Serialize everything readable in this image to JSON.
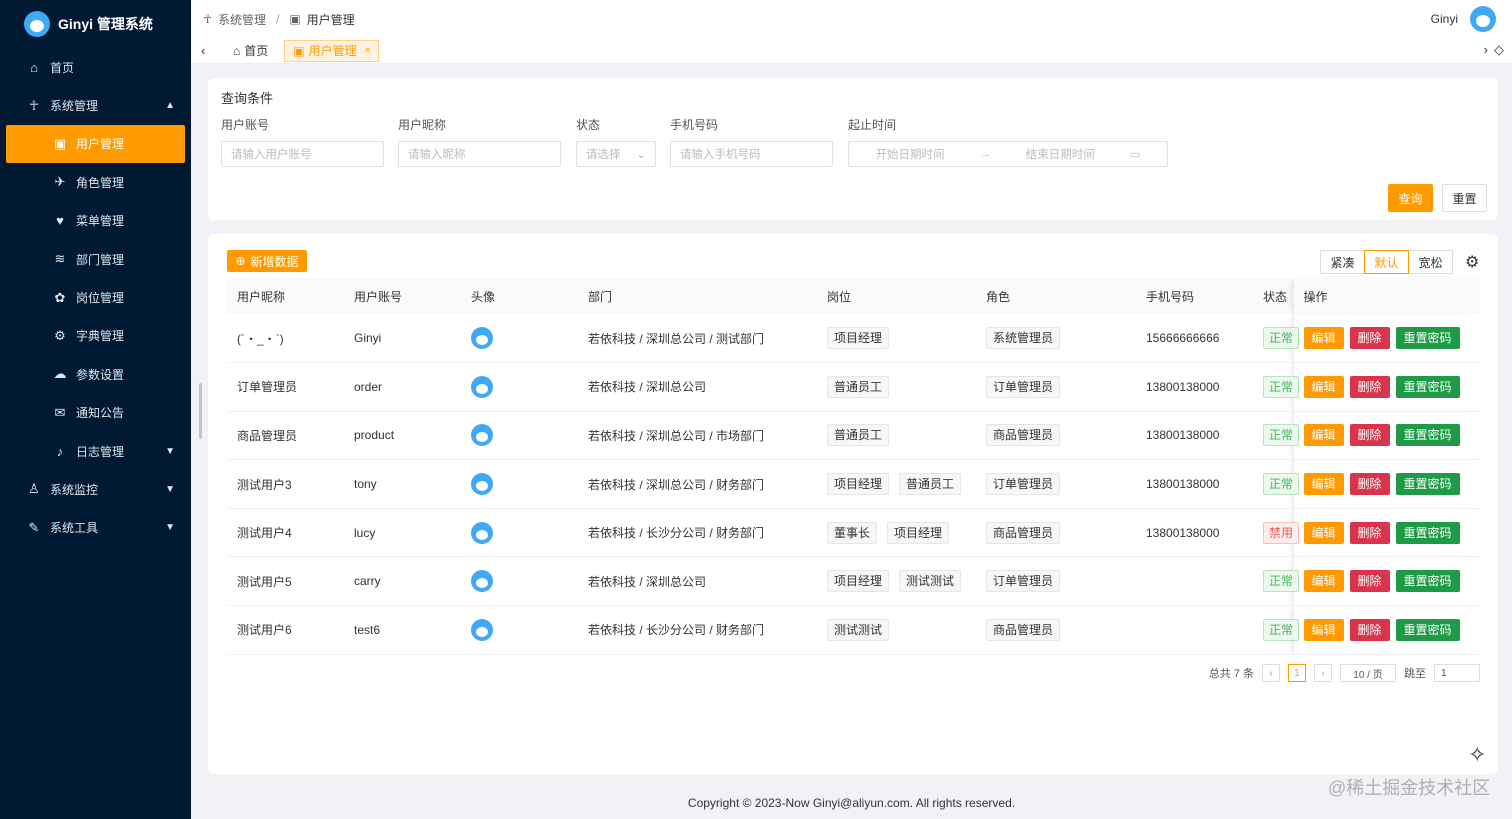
{
  "app": {
    "title": "Ginyi 管理系统"
  },
  "sidebar": {
    "items": [
      {
        "label": "首页",
        "icon": "⌂"
      },
      {
        "label": "系统管理",
        "icon": "☥",
        "arrow": "▲"
      },
      {
        "label": "用户管理",
        "icon": "▣"
      },
      {
        "label": "角色管理",
        "icon": "✈"
      },
      {
        "label": "菜单管理",
        "icon": "♥"
      },
      {
        "label": "部门管理",
        "icon": "≋"
      },
      {
        "label": "岗位管理",
        "icon": "✿"
      },
      {
        "label": "字典管理",
        "icon": "⚙"
      },
      {
        "label": "参数设置",
        "icon": "☁"
      },
      {
        "label": "通知公告",
        "icon": "✉"
      },
      {
        "label": "日志管理",
        "icon": "♪",
        "arrow": "▼"
      },
      {
        "label": "系统监控",
        "icon": "♙",
        "arrow": "▼"
      },
      {
        "label": "系统工具",
        "icon": "✎",
        "arrow": "▼"
      }
    ]
  },
  "header": {
    "breadcrumb": [
      "系统管理",
      "/",
      "用户管理"
    ],
    "user": "Ginyi"
  },
  "tabs": [
    {
      "label": "首页"
    },
    {
      "label": "用户管理"
    }
  ],
  "query": {
    "title": "查询条件",
    "fields": [
      {
        "label": "用户账号",
        "placeholder": "请输入用户账号"
      },
      {
        "label": "用户昵称",
        "placeholder": "请输入昵称"
      },
      {
        "label": "状态",
        "placeholder": "请选择"
      },
      {
        "label": "手机号码",
        "placeholder": "请输入手机号码"
      },
      {
        "label": "起止时间",
        "start": "开始日期时间",
        "end": "结束日期时间"
      }
    ],
    "search": "查询",
    "reset": "重置"
  },
  "table": {
    "add": "新增数据",
    "density": [
      "紧凑",
      "默认",
      "宽松"
    ],
    "columns": [
      "用户昵称",
      "用户账号",
      "头像",
      "部门",
      "岗位",
      "角色",
      "手机号码",
      "状态",
      "操作"
    ],
    "actions": {
      "edit": "编辑",
      "delete": "删除",
      "reset": "重置密码"
    },
    "rows": [
      {
        "nick": "(´・_・`)",
        "account": "Ginyi",
        "dept": "若依科技 / 深圳总公司 / 测试部门",
        "posts": [
          "项目经理"
        ],
        "role": "系统管理员",
        "phone": "15666666666",
        "status": "正常",
        "ok": true
      },
      {
        "nick": "订单管理员",
        "account": "order",
        "dept": "若依科技 / 深圳总公司",
        "posts": [
          "普通员工"
        ],
        "role": "订单管理员",
        "phone": "13800138000",
        "status": "正常",
        "ok": true
      },
      {
        "nick": "商品管理员",
        "account": "product",
        "dept": "若依科技 / 深圳总公司 / 市场部门",
        "posts": [
          "普通员工"
        ],
        "role": "商品管理员",
        "phone": "13800138000",
        "status": "正常",
        "ok": true
      },
      {
        "nick": "测试用户3",
        "account": "tony",
        "dept": "若依科技 / 深圳总公司 / 财务部门",
        "posts": [
          "项目经理",
          "普通员工"
        ],
        "role": "订单管理员",
        "phone": "13800138000",
        "status": "正常",
        "ok": true
      },
      {
        "nick": "测试用户4",
        "account": "lucy",
        "dept": "若依科技 / 长沙分公司 / 财务部门",
        "posts": [
          "董事长",
          "项目经理"
        ],
        "role": "商品管理员",
        "phone": "13800138000",
        "status": "禁用",
        "ok": false
      },
      {
        "nick": "测试用户5",
        "account": "carry",
        "dept": "若依科技 / 深圳总公司",
        "posts": [
          "项目经理",
          "测试测试"
        ],
        "role": "订单管理员",
        "phone": "",
        "status": "正常",
        "ok": true
      },
      {
        "nick": "测试用户6",
        "account": "test6",
        "dept": "若依科技 / 长沙分公司 / 财务部门",
        "posts": [
          "测试测试"
        ],
        "role": "商品管理员",
        "phone": "",
        "status": "正常",
        "ok": true
      }
    ]
  },
  "pager": {
    "total": "总共 7 条",
    "page": "1",
    "size": "10 / 页",
    "jump_label": "跳至",
    "jump_value": "1"
  },
  "footer": "Copyright © 2023-Now Ginyi@aliyun.com. All rights reserved.",
  "watermark": "@稀土掘金技术社区",
  "colors": {
    "accent": "#ff9a00",
    "sidebar": "#001a33",
    "danger": "#d9344b",
    "success": "#1f9b48"
  }
}
